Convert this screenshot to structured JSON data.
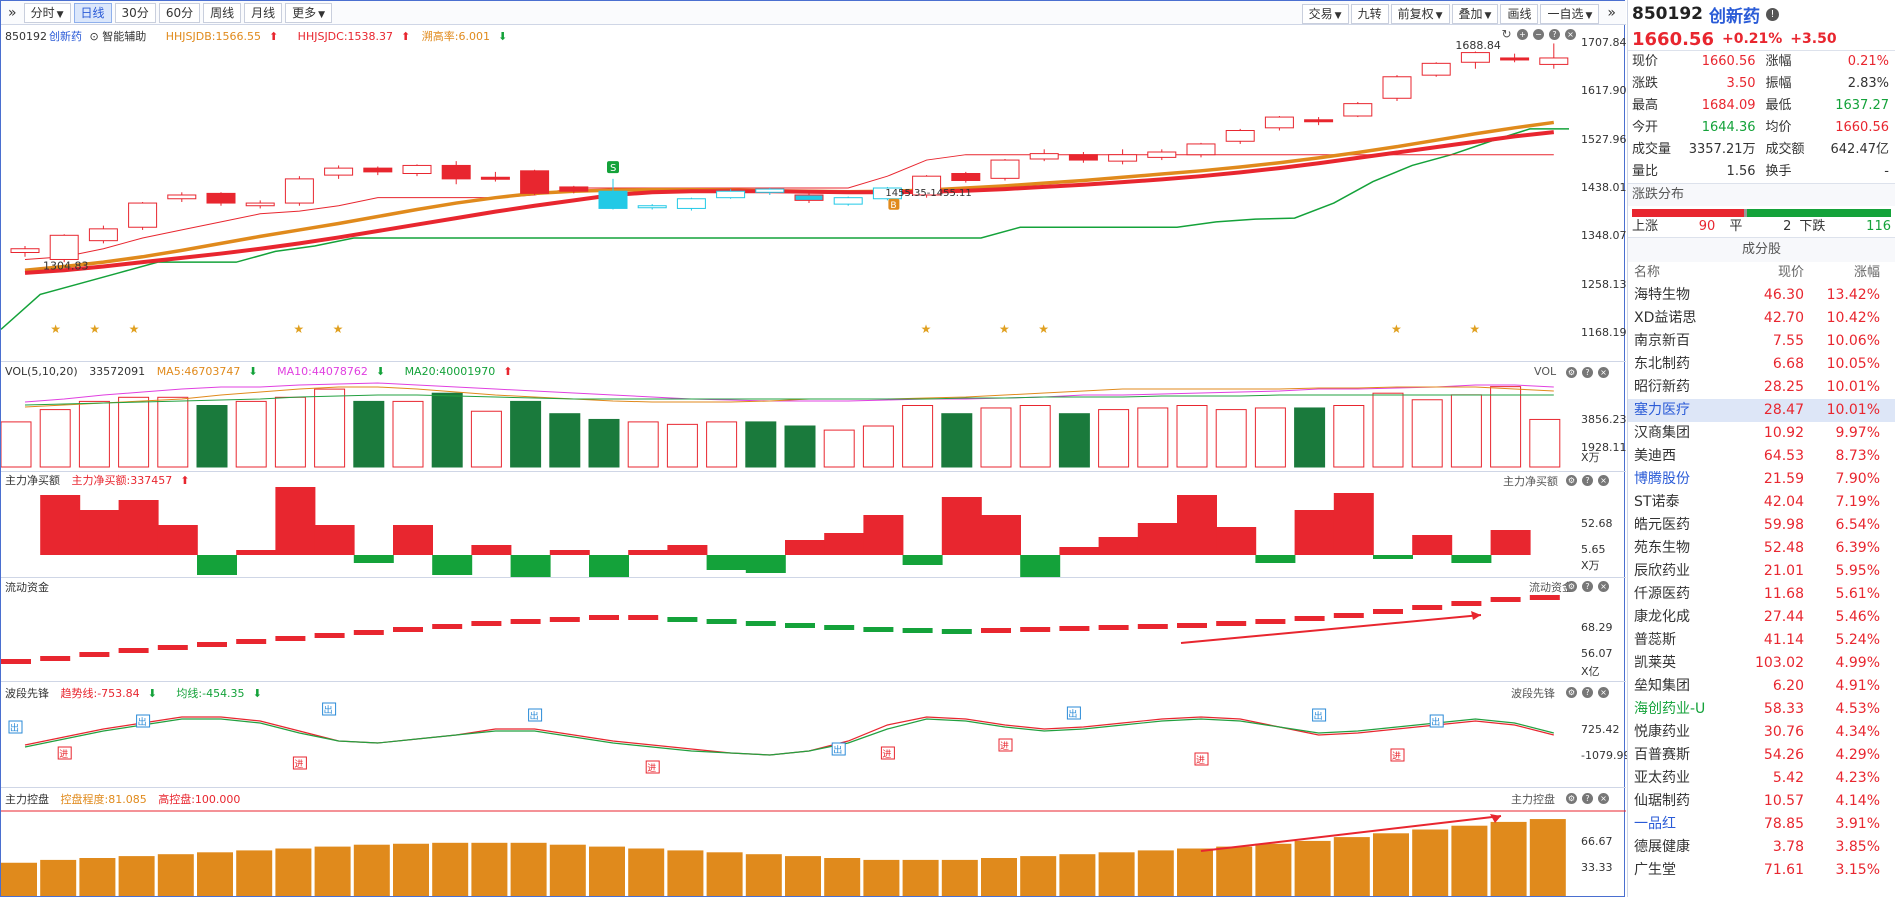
{
  "toolbar": {
    "tabs": [
      "分时",
      "日线",
      "30分",
      "60分",
      "周线",
      "月线",
      "更多"
    ],
    "right": [
      "交易",
      "九转",
      "前复权",
      "叠加",
      "画线",
      "一自选"
    ]
  },
  "stock": {
    "code": "850192",
    "name": "创新药",
    "price": "1660.56",
    "change_pct": "+0.21%",
    "change": "+3.50"
  },
  "main_chart": {
    "label_code": "850192",
    "label_name": "创新药",
    "assist": "智能辅助",
    "ind1": "HHJSJDB:1566.55",
    "ind2": "HHJSJDC:1538.37",
    "ind3": "溯高率:6.001",
    "y_ticks": [
      "1707.84",
      "1617.90",
      "1527.96",
      "1438.01",
      "1348.07",
      "1258.13",
      "1168.19"
    ],
    "high_label": "1688.84",
    "low_label": "1304.83",
    "mid_label": "1455.35-1455.11"
  },
  "vol_pane": {
    "title": "VOL(5,10,20)",
    "vol": "33572091",
    "ma5": "MA5:46703747",
    "ma10": "MA10:44078762",
    "ma20": "MA20:40001970",
    "right_title": "VOL",
    "y_ticks": [
      "3856.23",
      "1928.11"
    ],
    "unit": "X万"
  },
  "net_pane": {
    "title": "主力净买额",
    "val": "主力净买额:337457",
    "right_title": "主力净买额",
    "y_ticks": [
      "52.68",
      "5.65"
    ],
    "unit": "X万"
  },
  "flow_pane": {
    "title": "流动资金",
    "right_title": "流动资金",
    "y_ticks": [
      "68.29",
      "56.07"
    ],
    "unit": "X亿"
  },
  "wave_pane": {
    "title": "波段先锋",
    "trend": "趋势线:-753.84",
    "avg": "均线:-454.35",
    "right_title": "波段先锋",
    "y_ticks": [
      "725.42",
      "-1079.99"
    ],
    "in_label": "进",
    "out_label": "出"
  },
  "control_pane": {
    "title": "主力控盘",
    "degree": "控盘程度:81.085",
    "high": "高控盘:100.000",
    "right_title": "主力控盘",
    "y_ticks": [
      "66.67",
      "33.33"
    ]
  },
  "quote": {
    "rows": [
      [
        "现价",
        "1660.56",
        "涨幅",
        "0.21%"
      ],
      [
        "涨跌",
        "3.50",
        "振幅",
        "2.83%"
      ],
      [
        "最高",
        "1684.09",
        "最低",
        "1637.27"
      ],
      [
        "今开",
        "1644.36",
        "均价",
        "1660.56"
      ],
      [
        "成交量",
        "3357.21万",
        "成交额",
        "642.47亿"
      ],
      [
        "量比",
        "1.56",
        "换手",
        "-"
      ]
    ]
  },
  "distribution": {
    "title": "涨跌分布",
    "up_label": "上涨",
    "up": "90",
    "flat_label": "平",
    "flat": "2",
    "down_label": "下跌",
    "down": "116"
  },
  "constituents": {
    "title": "成分股",
    "head": [
      "名称",
      "现价",
      "涨幅"
    ],
    "rows": [
      [
        "海特生物",
        "46.30",
        "13.42%"
      ],
      [
        "XD益诺思",
        "42.70",
        "10.42%"
      ],
      [
        "南京新百",
        "7.55",
        "10.06%"
      ],
      [
        "东北制药",
        "6.68",
        "10.05%"
      ],
      [
        "昭衍新药",
        "28.25",
        "10.01%"
      ],
      [
        "塞力医疗",
        "28.47",
        "10.01%"
      ],
      [
        "汉商集团",
        "10.92",
        "9.97%"
      ],
      [
        "美迪西",
        "64.53",
        "8.73%"
      ],
      [
        "博腾股份",
        "21.59",
        "7.90%"
      ],
      [
        "ST诺泰",
        "42.04",
        "7.19%"
      ],
      [
        "皓元医药",
        "59.98",
        "6.54%"
      ],
      [
        "苑东生物",
        "52.48",
        "6.39%"
      ],
      [
        "辰欣药业",
        "21.01",
        "5.95%"
      ],
      [
        "仟源医药",
        "11.68",
        "5.61%"
      ],
      [
        "康龙化成",
        "27.44",
        "5.46%"
      ],
      [
        "普蕊斯",
        "41.14",
        "5.24%"
      ],
      [
        "凯莱英",
        "103.02",
        "4.99%"
      ],
      [
        "垒知集团",
        "6.20",
        "4.91%"
      ],
      [
        "海创药业-U",
        "58.33",
        "4.53%"
      ],
      [
        "悦康药业",
        "30.76",
        "4.34%"
      ],
      [
        "百普赛斯",
        "54.26",
        "4.29%"
      ],
      [
        "亚太药业",
        "5.42",
        "4.23%"
      ],
      [
        "仙琚制药",
        "10.57",
        "4.14%"
      ],
      [
        "一品红",
        "78.85",
        "3.91%"
      ],
      [
        "德展健康",
        "3.78",
        "3.85%"
      ],
      [
        "广生堂",
        "71.61",
        "3.15%"
      ]
    ]
  },
  "colors": {
    "up": "#e8262f",
    "down": "#14a23a",
    "vol_down": "#1a7a3c",
    "accent": "#2a5bd7",
    "orange": "#e08a1c",
    "magenta": "#e040e0",
    "cyan": "#22c9e6"
  },
  "candles": [
    [
      1318,
      1325,
      1310,
      1330,
      "u"
    ],
    [
      1305,
      1350,
      1300,
      1352,
      "u"
    ],
    [
      1340,
      1362,
      1335,
      1368,
      "u"
    ],
    [
      1365,
      1410,
      1360,
      1412,
      "u"
    ],
    [
      1418,
      1425,
      1412,
      1430,
      "u"
    ],
    [
      1428,
      1410,
      1405,
      1430,
      "d"
    ],
    [
      1405,
      1410,
      1400,
      1415,
      "u"
    ],
    [
      1410,
      1455,
      1405,
      1460,
      "u"
    ],
    [
      1462,
      1475,
      1455,
      1480,
      "u"
    ],
    [
      1475,
      1468,
      1462,
      1478,
      "d"
    ],
    [
      1465,
      1480,
      1460,
      1482,
      "u"
    ],
    [
      1480,
      1455,
      1445,
      1488,
      "d"
    ],
    [
      1458,
      1455,
      1450,
      1468,
      "d"
    ],
    [
      1470,
      1428,
      1425,
      1472,
      "d"
    ],
    [
      1440,
      1432,
      1428,
      1442,
      "d"
    ],
    [
      1432,
      1400,
      1398,
      1455,
      "c"
    ],
    [
      1405,
      1402,
      1398,
      1408,
      "c"
    ],
    [
      1400,
      1418,
      1396,
      1420,
      "c"
    ],
    [
      1420,
      1432,
      1418,
      1436,
      "c"
    ],
    [
      1436,
      1430,
      1425,
      1438,
      "c"
    ],
    [
      1425,
      1415,
      1410,
      1428,
      "g"
    ],
    [
      1408,
      1420,
      1405,
      1422,
      "c"
    ],
    [
      1418,
      1438,
      1415,
      1440,
      "c"
    ],
    [
      1425,
      1460,
      1420,
      1462,
      "u"
    ],
    [
      1465,
      1452,
      1448,
      1468,
      "d"
    ],
    [
      1456,
      1490,
      1452,
      1492,
      "u"
    ],
    [
      1492,
      1502,
      1488,
      1510,
      "u"
    ],
    [
      1500,
      1490,
      1485,
      1505,
      "d"
    ],
    [
      1488,
      1500,
      1482,
      1510,
      "u"
    ],
    [
      1495,
      1505,
      1490,
      1510,
      "u"
    ],
    [
      1500,
      1520,
      1495,
      1522,
      "u"
    ],
    [
      1525,
      1545,
      1520,
      1548,
      "u"
    ],
    [
      1550,
      1570,
      1545,
      1572,
      "u"
    ],
    [
      1565,
      1562,
      1555,
      1570,
      "d"
    ],
    [
      1572,
      1595,
      1570,
      1598,
      "u"
    ],
    [
      1605,
      1645,
      1600,
      1648,
      "u"
    ],
    [
      1648,
      1670,
      1645,
      1672,
      "u"
    ],
    [
      1672,
      1690,
      1660,
      1692,
      "u"
    ],
    [
      1680,
      1678,
      1672,
      1688,
      "d"
    ],
    [
      1668,
      1680,
      1660,
      1707,
      "u"
    ]
  ],
  "vol_bars": [
    [
      55,
      "u"
    ],
    [
      70,
      "u"
    ],
    [
      80,
      "u"
    ],
    [
      85,
      "u"
    ],
    [
      85,
      "u"
    ],
    [
      75,
      "g"
    ],
    [
      80,
      "u"
    ],
    [
      85,
      "u"
    ],
    [
      95,
      "u"
    ],
    [
      80,
      "g"
    ],
    [
      80,
      "u"
    ],
    [
      90,
      "g"
    ],
    [
      68,
      "u"
    ],
    [
      80,
      "g"
    ],
    [
      65,
      "g"
    ],
    [
      58,
      "g"
    ],
    [
      55,
      "u"
    ],
    [
      52,
      "u"
    ],
    [
      55,
      "u"
    ],
    [
      55,
      "g"
    ],
    [
      50,
      "g"
    ],
    [
      45,
      "u"
    ],
    [
      50,
      "u"
    ],
    [
      75,
      "u"
    ],
    [
      65,
      "g"
    ],
    [
      72,
      "u"
    ],
    [
      75,
      "u"
    ],
    [
      65,
      "g"
    ],
    [
      70,
      "u"
    ],
    [
      72,
      "u"
    ],
    [
      75,
      "u"
    ],
    [
      70,
      "u"
    ],
    [
      72,
      "u"
    ],
    [
      72,
      "g"
    ],
    [
      75,
      "u"
    ],
    [
      90,
      "u"
    ],
    [
      82,
      "u"
    ],
    [
      88,
      "u"
    ],
    [
      98,
      "u"
    ],
    [
      58,
      "u"
    ]
  ],
  "net_bars": [
    0,
    60,
    45,
    55,
    30,
    -20,
    5,
    75,
    30,
    -8,
    30,
    -20,
    10,
    -25,
    5,
    -30,
    5,
    10,
    -15,
    -18,
    15,
    22,
    40,
    -10,
    58,
    40,
    -22,
    8,
    18,
    32,
    60,
    28,
    -8,
    45,
    62,
    -4,
    20,
    -8,
    25,
    0
  ],
  "flow_steps": [
    12,
    15,
    19,
    23,
    26,
    29,
    32,
    35,
    38,
    41,
    44,
    47,
    50,
    52,
    54,
    56,
    56,
    54,
    52,
    50,
    48,
    46,
    44,
    43,
    42,
    43,
    44,
    45,
    46,
    47,
    48,
    50,
    52,
    55,
    58,
    62,
    66,
    70,
    74,
    76
  ],
  "control_bars": [
    35,
    38,
    40,
    42,
    44,
    46,
    48,
    50,
    52,
    54,
    55,
    56,
    56,
    56,
    54,
    52,
    50,
    48,
    46,
    44,
    42,
    40,
    38,
    38,
    38,
    40,
    42,
    44,
    46,
    48,
    50,
    52,
    55,
    58,
    62,
    66,
    70,
    74,
    78,
    81
  ]
}
